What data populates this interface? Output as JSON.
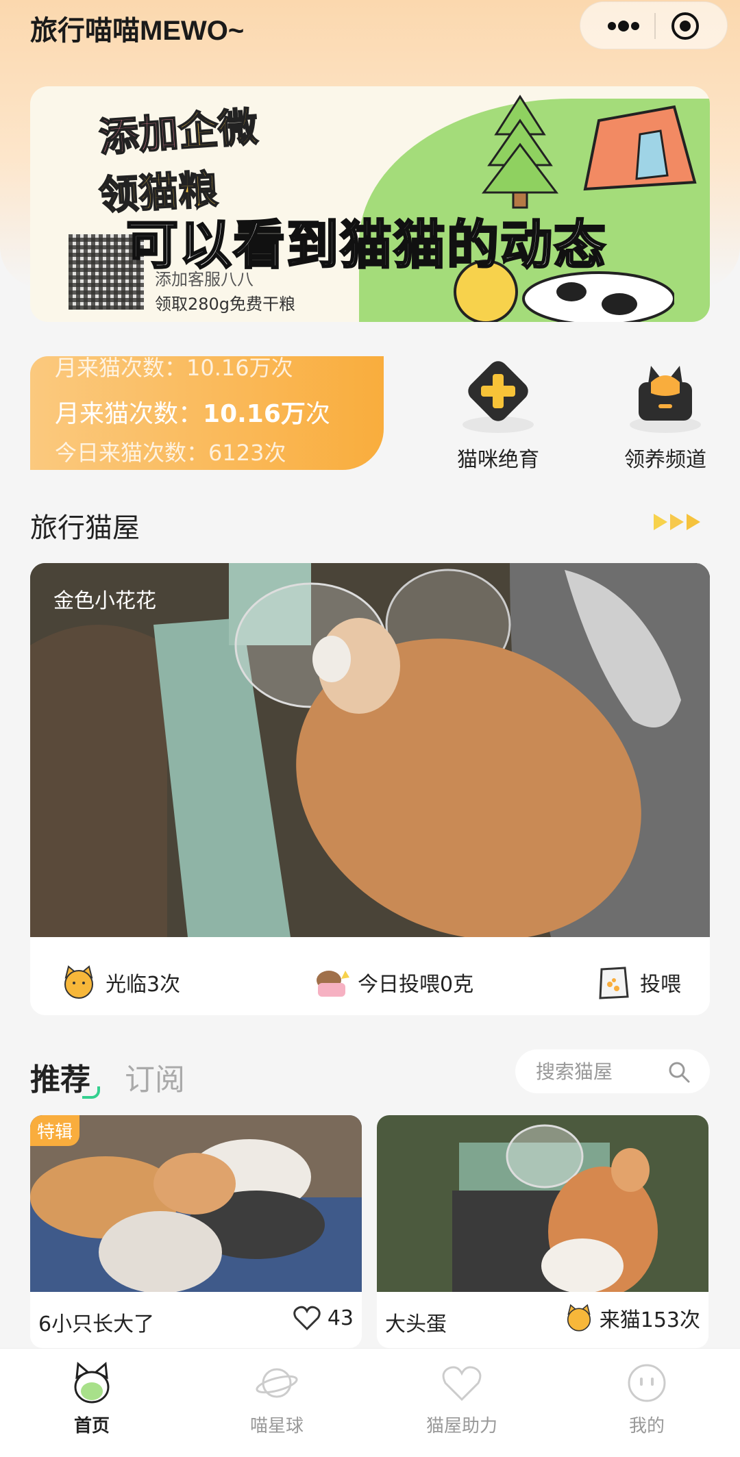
{
  "header": {
    "app_title": "旅行喵喵MEWO~"
  },
  "banner": {
    "headline_part1": "添加",
    "headline_part2": "企微",
    "headline_line2": "领猫粮",
    "subline1": "添加客服八八",
    "subline2": "领取280g免费干粮",
    "overlay_caption": "可以看到猫猫的动态"
  },
  "stats": {
    "ghost_top": "月来猫次数：10.16万次",
    "label": "月来猫次数：",
    "value": "10.16万",
    "unit": "次",
    "ghost_bottom": "今日来猫次数：6123次"
  },
  "shortcuts": [
    {
      "label": "猫咪绝育",
      "icon": "plus-icon"
    },
    {
      "label": "领养频道",
      "icon": "cat-house-icon"
    }
  ],
  "section": {
    "title": "旅行猫屋"
  },
  "live_feed": {
    "camera_name": "金色小花花",
    "visits": "光临3次",
    "fed_today": "今日投喂0克",
    "feed_button": "投喂"
  },
  "tabs": {
    "recommend": "推荐",
    "subscribe": "订阅"
  },
  "search": {
    "placeholder": "搜索猫屋"
  },
  "cards": [
    {
      "badge": "特辑",
      "title": "6小只长大了",
      "likes": "43"
    },
    {
      "title": "大头蛋",
      "visits": "来猫153次"
    }
  ],
  "tabbar": [
    {
      "label": "首页",
      "active": true
    },
    {
      "label": "喵星球"
    },
    {
      "label": "猫屋助力"
    },
    {
      "label": "我的"
    }
  ],
  "colors": {
    "accent": "#f9ad3d",
    "green": "#34d08f",
    "banner_hill": "#a4dc7a"
  }
}
